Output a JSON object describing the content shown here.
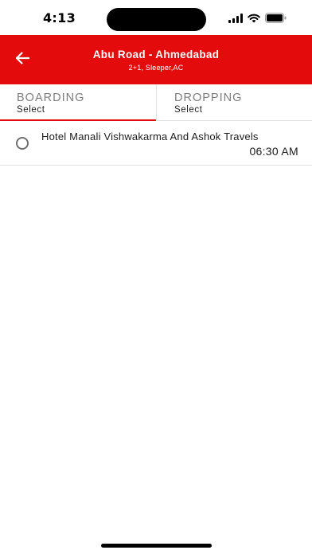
{
  "status_bar": {
    "time": "4:13",
    "icons": [
      "cellular-signal-icon",
      "wifi-icon",
      "battery-icon"
    ]
  },
  "header": {
    "title": "Abu Road - Ahmedabad",
    "subtitle": "2+1, Sleeper,AC",
    "back_icon": "arrow-left-icon",
    "background_color": "#e30b0b"
  },
  "tabs": [
    {
      "heading": "BOARDING",
      "value": "Select",
      "active": true
    },
    {
      "heading": "DROPPING",
      "value": "Select",
      "active": false
    }
  ],
  "points": [
    {
      "name": "Hotel Manali Vishwakarma And Ashok Travels",
      "time": "06:30 AM",
      "selected": false
    }
  ],
  "colors": {
    "accent": "#e30b0b",
    "divider": "#e2e2e2",
    "tab_heading": "#7c7c7c"
  }
}
